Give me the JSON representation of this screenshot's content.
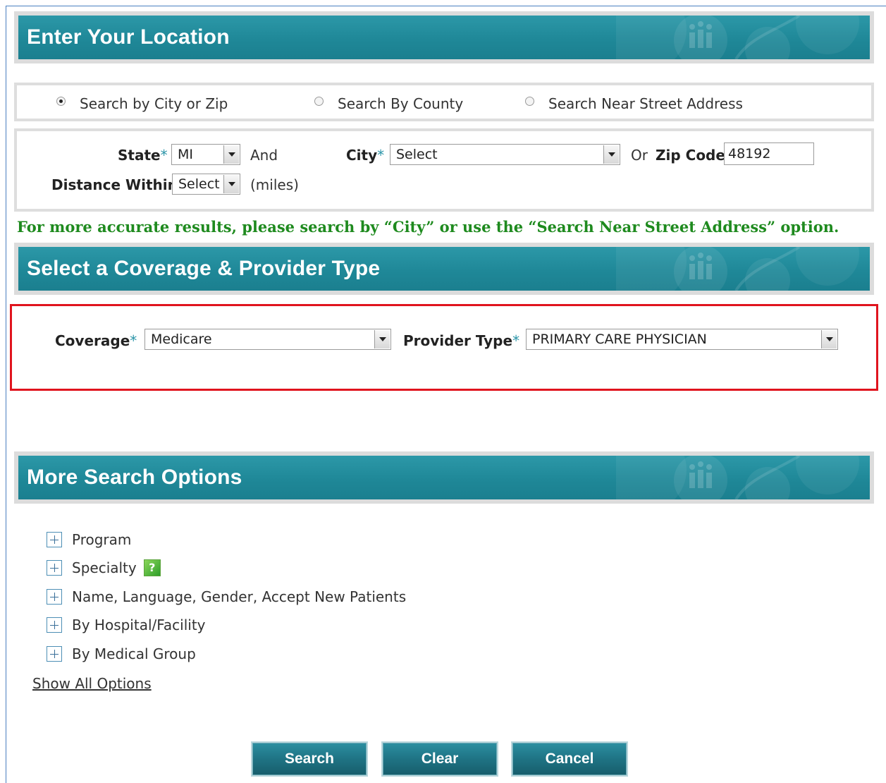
{
  "location": {
    "title": "Enter Your Location",
    "search_modes": [
      {
        "label": "Search by City or Zip",
        "checked": true
      },
      {
        "label": "Search By County",
        "checked": false
      },
      {
        "label": "Search Near Street Address",
        "checked": false
      }
    ],
    "state_label": "State",
    "state_value": "MI",
    "and_text": "And",
    "city_label": "City",
    "city_value": "Select",
    "or_text": "Or",
    "zip_label": "Zip Code",
    "zip_value": "48192",
    "distance_label": "Distance Within",
    "distance_value": "Select",
    "miles_text": "(miles)",
    "required_marker": "*",
    "notice": "For more accurate results, please search by “City” or use the “Search Near Street Address” option."
  },
  "coverage": {
    "title": "Select a Coverage & Provider Type",
    "coverage_label": "Coverage",
    "coverage_value": "Medicare",
    "provider_label": "Provider Type",
    "provider_value": "PRIMARY CARE PHYSICIAN",
    "required_marker": "*"
  },
  "more_options": {
    "title": "More Search Options",
    "items": [
      {
        "label": "Program"
      },
      {
        "label": "Specialty"
      },
      {
        "label": "Name, Language, Gender, Accept New Patients"
      },
      {
        "label": "By Hospital/Facility"
      },
      {
        "label": "By Medical Group"
      }
    ],
    "help_glyph": "?",
    "show_all": "Show All Options"
  },
  "buttons": {
    "search": "Search",
    "clear": "Clear",
    "cancel": "Cancel"
  },
  "colors": {
    "banner": "#1f8898",
    "required": "#2b95a8",
    "notice": "#1e8a1e",
    "highlight": "#e0141e"
  },
  "icons": {
    "banner_decoration": "people-icon",
    "expand": "plus-icon",
    "help": "help-icon",
    "dropdown": "chevron-down-icon"
  }
}
